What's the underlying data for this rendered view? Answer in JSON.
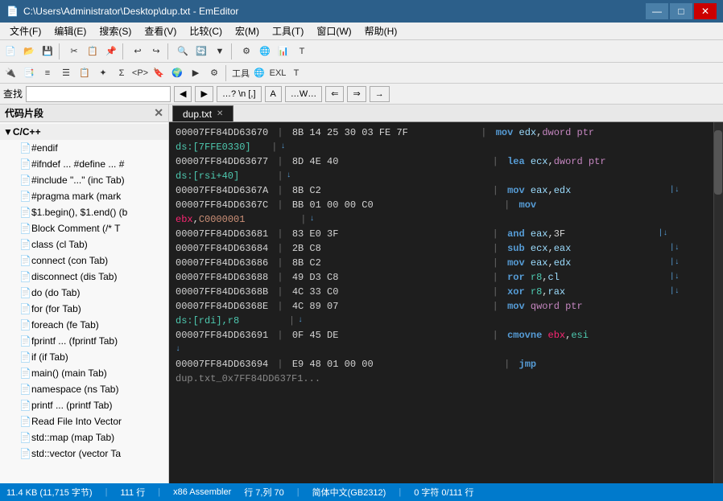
{
  "titleBar": {
    "title": "C:\\Users\\Administrator\\Desktop\\dup.txt - EmEditor",
    "minimize": "—",
    "maximize": "□",
    "close": "✕"
  },
  "menuBar": {
    "items": [
      "文件(F)",
      "编辑(E)",
      "搜索(S)",
      "查看(V)",
      "比较(C)",
      "宏(M)",
      "工具(T)",
      "窗口(W)",
      "帮助(H)"
    ]
  },
  "findBar": {
    "label": "查找",
    "placeholder": ""
  },
  "leftPanel": {
    "title": "代码片段",
    "groupLabel": "C/C++",
    "items": [
      "#endif",
      "#ifndef ... #define ... #",
      "#include \"...\" (inc Tab)",
      "#pragma mark (mark",
      "$1.begin(), $1.end() (b",
      "Block Comment (/* T",
      "class  (cl Tab)",
      "connect  (con Tab)",
      "disconnect  (dis Tab)",
      "do  (do Tab)",
      "for  (for Tab)",
      "foreach  (fe Tab)",
      "fprintf ...  (fprintf Tab)",
      "if  (if Tab)",
      "main()  (main Tab)",
      "namespace  (ns Tab)",
      "printf ...  (printf Tab)",
      "Read File Into Vector",
      "std::map  (map Tab)",
      "std::vector  (vector Ta"
    ]
  },
  "tabs": [
    {
      "label": "dup.txt",
      "active": true
    }
  ],
  "codeLines": [
    {
      "addr": "00007FF84DD63670",
      "hex": "| 8B 14 25 30 03 FE 7F",
      "spaces": "            ",
      "instr": "| mov edx,dword ptr"
    },
    {
      "addr": "ds:[7FFE0330]",
      "hex": "",
      "spaces": "   ",
      "instr": "|↓",
      "indent": true
    },
    {
      "addr": "00007FF84DD63677",
      "hex": "| 8D 4E 40",
      "spaces": "                          ",
      "instr": "| lea ecx,dword ptr"
    },
    {
      "addr": "ds:[rsi+40]",
      "hex": "",
      "spaces": "      ",
      "instr": "|↓",
      "indent": true
    },
    {
      "addr": "00007FF84DD6367A",
      "hex": "| 8B C2",
      "spaces": "                             ",
      "instr": "| mov eax,edx",
      "arrow": true
    },
    {
      "addr": "00007FF84DD6367C",
      "hex": "| BB 01 00 00 C0",
      "spaces": "                      ",
      "instr": "| mov"
    },
    {
      "addr": "ebx,C0000001",
      "hex": "",
      "spaces": "         ",
      "instr": "|↓",
      "indent": true
    },
    {
      "addr": "00007FF84DD63681",
      "hex": "| 83 E0 3F",
      "spaces": "                          ",
      "instr": "| and eax,3F",
      "arrow": true
    },
    {
      "addr": "00007FF84DD63684",
      "hex": "| 2B C8",
      "spaces": "                             ",
      "instr": "| sub ecx,eax",
      "arrow": true
    },
    {
      "addr": "00007FF84DD63686",
      "hex": "| 8B C2",
      "spaces": "                             ",
      "instr": "| mov eax,edx",
      "arrow": true
    },
    {
      "addr": "00007FF84DD63688",
      "hex": "| 49 D3 C8",
      "spaces": "                          ",
      "instr": "| ror r8,cl",
      "arrow": true
    },
    {
      "addr": "00007FF84DD6368B",
      "hex": "| 4C 33 C0",
      "spaces": "                          ",
      "instr": "| xor r8,rax",
      "arrow": true
    },
    {
      "addr": "00007FF84DD6368E",
      "hex": "| 4C 89 07",
      "spaces": "                          ",
      "instr": "| mov qword ptr"
    },
    {
      "addr": "ds:[rdi],r8",
      "hex": "",
      "spaces": "        ",
      "instr": "|↓",
      "indent": true
    },
    {
      "addr": "00007FF84DD63691",
      "hex": "| 0F 45 DE",
      "spaces": "                          ",
      "instr": "| cmovne ebx,esi"
    },
    {
      "addr": "↓",
      "hex": "",
      "spaces": "",
      "instr": ""
    },
    {
      "addr": "00007FF84DD63694",
      "hex": "| E9 48 01 00 00",
      "spaces": "                      ",
      "instr": "| jmp"
    }
  ],
  "statusBar": {
    "fileSize": "11.4 KB (11,715 字节)",
    "lines": "111 行",
    "encoding": "x86 Assembler",
    "position": "行 7,列 70",
    "charset": "简体中文(GB2312)",
    "selection": "0 字符 0/111 行"
  }
}
